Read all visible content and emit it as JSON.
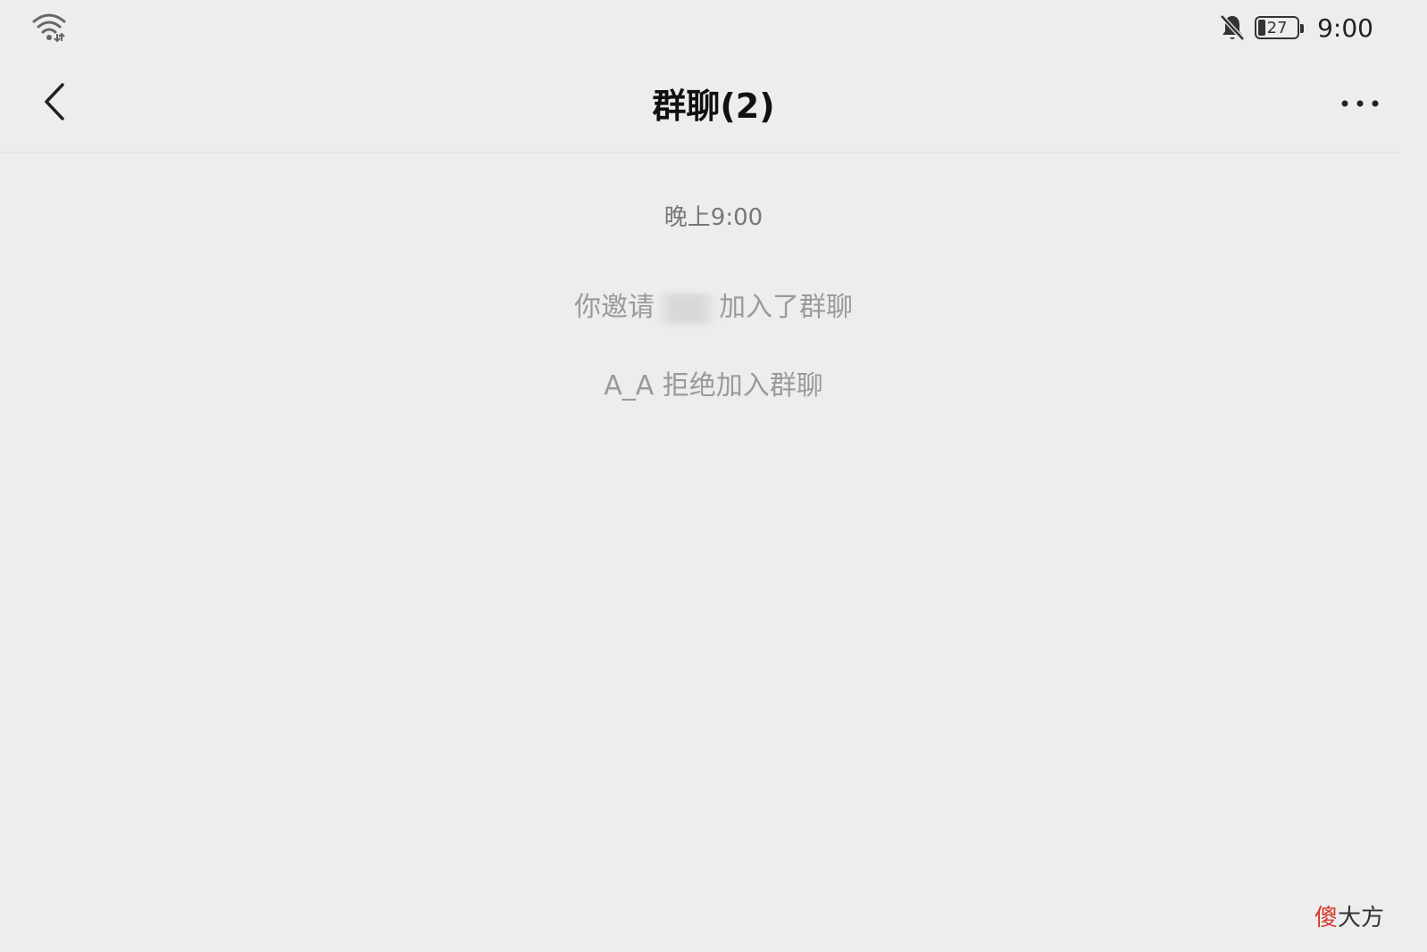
{
  "status_bar": {
    "wifi_icon": "wifi-icon",
    "bell_icon": "bell-muted-icon",
    "battery_level": "27",
    "time": "9:00"
  },
  "header": {
    "title": "群聊(2)",
    "back_icon": "chevron-left-icon",
    "more_icon": "more-dots-icon"
  },
  "chat": {
    "timestamp": "晚上9:00",
    "messages": [
      {
        "prefix": "你邀请",
        "suffix": "加入了群聊"
      },
      {
        "text": "A_A 拒绝加入群聊"
      }
    ]
  },
  "watermark": {
    "accent_text": "傻",
    "text": "大方",
    "accent_color": "#d6382c"
  }
}
